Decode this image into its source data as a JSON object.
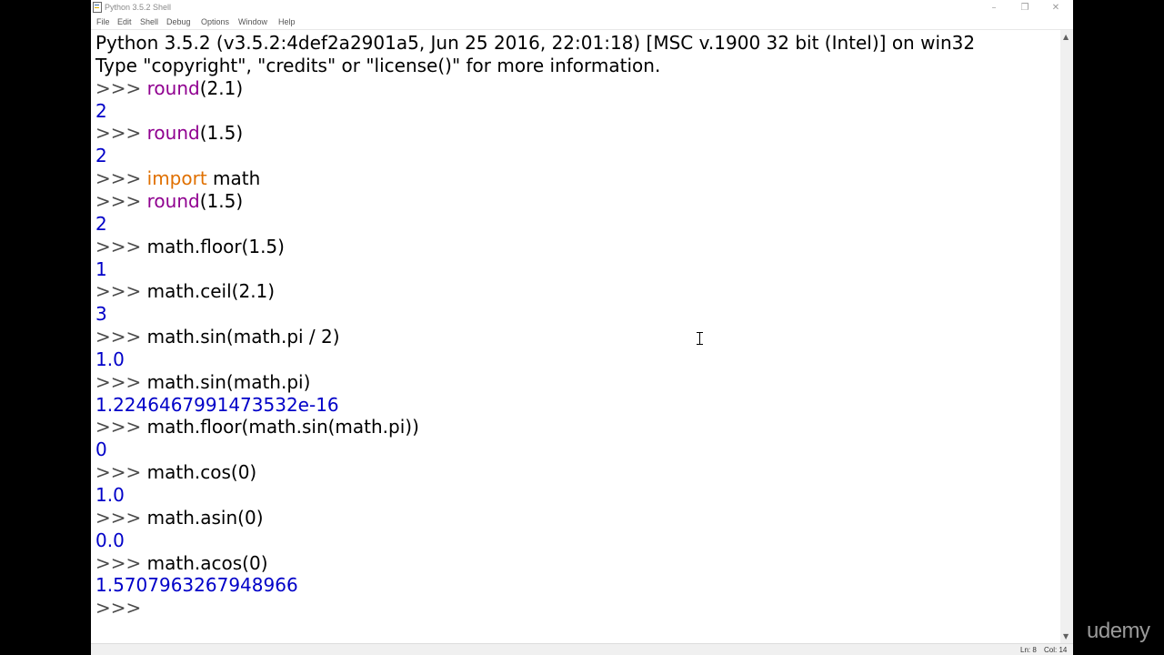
{
  "window": {
    "title": "Python 3.5.2 Shell",
    "controls": {
      "minimize": "–",
      "restore": "❐",
      "close": "✕"
    }
  },
  "menubar": [
    "File",
    "Edit",
    "Shell",
    "Debug",
    "Options",
    "Window",
    "Help"
  ],
  "shell": {
    "banner": [
      "Python 3.5.2 (v3.5.2:4def2a2901a5, Jun 25 2016, 22:01:18) [MSC v.1900 32 bit (Intel)] on win32",
      "Type \"copyright\", \"credits\" or \"license()\" for more information."
    ],
    "prompt": ">>> ",
    "entries": [
      {
        "input": [
          {
            "t": "round",
            "c": "builtin"
          },
          {
            "t": "(2.1)",
            "c": ""
          }
        ],
        "output": "2"
      },
      {
        "input": [
          {
            "t": "round",
            "c": "builtin"
          },
          {
            "t": "(1.5)",
            "c": ""
          }
        ],
        "output": "2"
      },
      {
        "input": [
          {
            "t": "import",
            "c": "kw"
          },
          {
            "t": " math",
            "c": ""
          }
        ],
        "output": null
      },
      {
        "input": [
          {
            "t": "round",
            "c": "builtin"
          },
          {
            "t": "(1.5)",
            "c": ""
          }
        ],
        "output": "2"
      },
      {
        "input": [
          {
            "t": "math.floor(1.5)",
            "c": ""
          }
        ],
        "output": "1"
      },
      {
        "input": [
          {
            "t": "math.ceil(2.1)",
            "c": ""
          }
        ],
        "output": "3"
      },
      {
        "input": [
          {
            "t": "math.sin(math.pi / 2)",
            "c": ""
          }
        ],
        "output": "1.0"
      },
      {
        "input": [
          {
            "t": "math.sin(math.pi)",
            "c": ""
          }
        ],
        "output": "1.2246467991473532e-16"
      },
      {
        "input": [
          {
            "t": "math.floor(math.sin(math.pi))",
            "c": ""
          }
        ],
        "output": "0"
      },
      {
        "input": [
          {
            "t": "math.cos(0)",
            "c": ""
          }
        ],
        "output": "1.0"
      },
      {
        "input": [
          {
            "t": "math.asin(0)",
            "c": ""
          }
        ],
        "output": "0.0"
      },
      {
        "input": [
          {
            "t": "math.acos(0)",
            "c": ""
          }
        ],
        "output": "1.5707963267948966"
      }
    ],
    "current_prompt": ">>> "
  },
  "statusbar": {
    "line": "Ln: 8",
    "col": "Col: 14"
  },
  "watermark": "udemy",
  "colors": {
    "builtin": "#900090",
    "keyword": "#e07000",
    "output": "#0000c8",
    "prompt": "#4a4a4a"
  },
  "icons": {
    "app": "python-idle-icon",
    "cursor": "i-beam-cursor-icon"
  }
}
